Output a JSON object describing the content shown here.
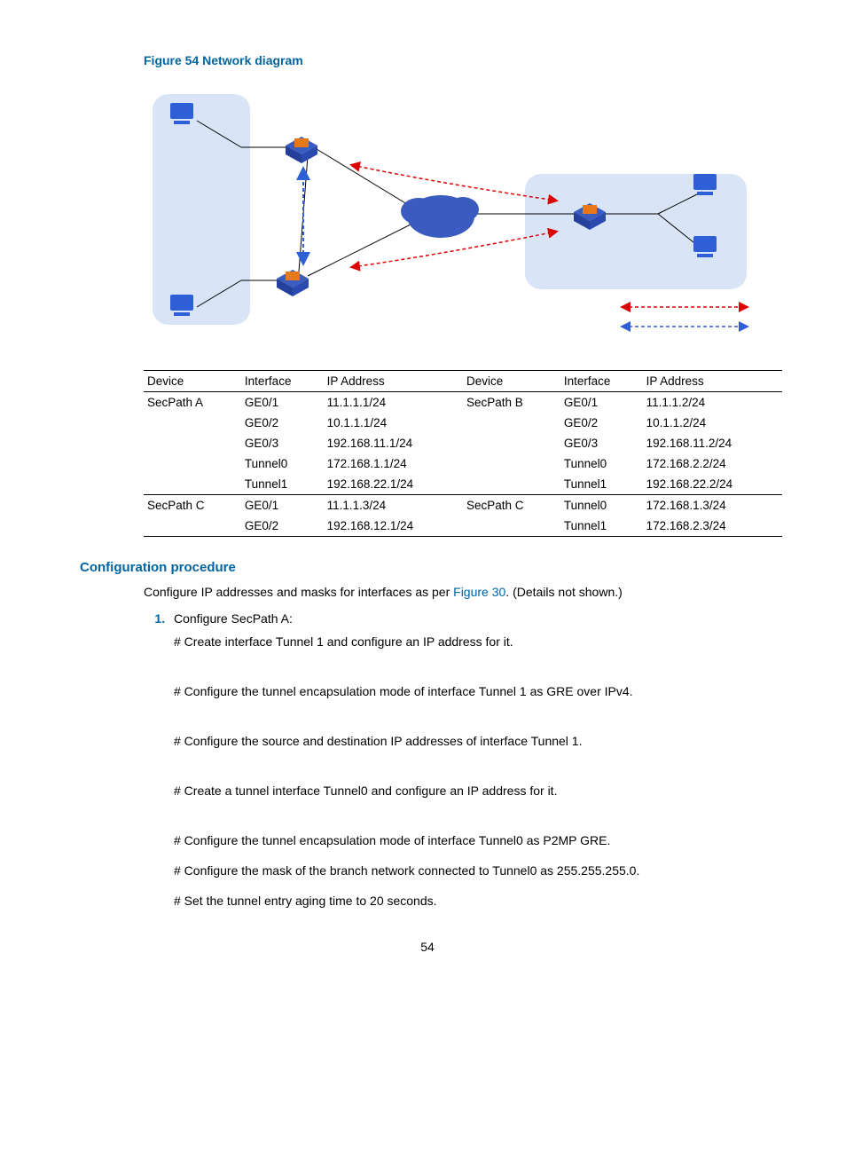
{
  "figure": {
    "caption": "Figure 54 Network diagram"
  },
  "table": {
    "headers": [
      "Device",
      "Interface",
      "IP Address",
      "Device",
      "Interface",
      "IP Address"
    ],
    "rows": [
      [
        "SecPath A",
        "GE0/1",
        "11.1.1.1/24",
        "SecPath B",
        "GE0/1",
        "11.1.1.2/24"
      ],
      [
        "",
        "GE0/2",
        "10.1.1.1/24",
        "",
        "GE0/2",
        "10.1.1.2/24"
      ],
      [
        "",
        "GE0/3",
        "192.168.11.1/24",
        "",
        "GE0/3",
        "192.168.11.2/24"
      ],
      [
        "",
        "Tunnel0",
        "172.168.1.1/24",
        "",
        "Tunnel0",
        "172.168.2.2/24"
      ],
      [
        "",
        "Tunnel1",
        "192.168.22.1/24",
        "",
        "Tunnel1",
        "192.168.22.2/24"
      ],
      [
        "SecPath C",
        "GE0/1",
        "11.1.1.3/24",
        "SecPath C",
        "Tunnel0",
        "172.168.1.3/24"
      ],
      [
        "",
        "GE0/2",
        "192.168.12.1/24",
        "",
        "Tunnel1",
        "172.168.2.3/24"
      ]
    ]
  },
  "section_heading": "Configuration procedure",
  "intro": {
    "pre": "Configure IP addresses and masks for interfaces as per ",
    "link": "Figure 30",
    "post": ". (Details not shown.)"
  },
  "step1": {
    "title": "Configure SecPath A:",
    "paras": [
      "# Create interface Tunnel 1 and configure an IP address for it.",
      "# Configure the tunnel encapsulation mode of interface Tunnel 1 as GRE over IPv4.",
      "# Configure the source and destination IP addresses of interface Tunnel 1.",
      "# Create a tunnel interface Tunnel0 and configure an IP address for it.",
      "# Configure the tunnel encapsulation mode of interface Tunnel0 as P2MP GRE.",
      "# Configure the mask of the branch network connected to Tunnel0 as 255.255.255.0.",
      "# Set the tunnel entry aging time to 20 seconds."
    ]
  },
  "page_number": "54"
}
